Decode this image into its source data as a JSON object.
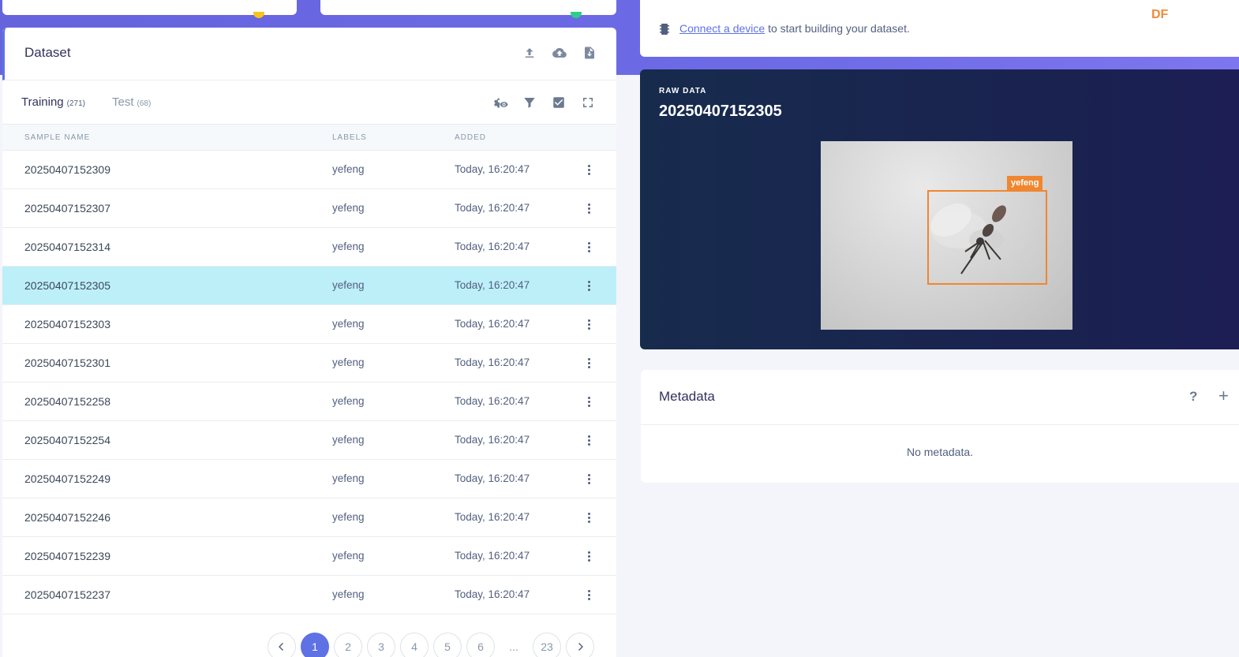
{
  "dataset": {
    "title": "Dataset",
    "tabs": {
      "training_label": "Training",
      "training_count": "(271)",
      "test_label": "Test",
      "test_count": "(68)"
    },
    "columns": {
      "name": "SAMPLE NAME",
      "labels": "LABELS",
      "added": "ADDED"
    },
    "rows": [
      {
        "name": "20250407152309",
        "label": "yefeng",
        "added": "Today, 16:20:47"
      },
      {
        "name": "20250407152307",
        "label": "yefeng",
        "added": "Today, 16:20:47"
      },
      {
        "name": "20250407152314",
        "label": "yefeng",
        "added": "Today, 16:20:47"
      },
      {
        "name": "20250407152305",
        "label": "yefeng",
        "added": "Today, 16:20:47"
      },
      {
        "name": "20250407152303",
        "label": "yefeng",
        "added": "Today, 16:20:47"
      },
      {
        "name": "20250407152301",
        "label": "yefeng",
        "added": "Today, 16:20:47"
      },
      {
        "name": "20250407152258",
        "label": "yefeng",
        "added": "Today, 16:20:47"
      },
      {
        "name": "20250407152254",
        "label": "yefeng",
        "added": "Today, 16:20:47"
      },
      {
        "name": "20250407152249",
        "label": "yefeng",
        "added": "Today, 16:20:47"
      },
      {
        "name": "20250407152246",
        "label": "yefeng",
        "added": "Today, 16:20:47"
      },
      {
        "name": "20250407152239",
        "label": "yefeng",
        "added": "Today, 16:20:47"
      },
      {
        "name": "20250407152237",
        "label": "yefeng",
        "added": "Today, 16:20:47"
      }
    ],
    "pagination": [
      "1",
      "2",
      "3",
      "4",
      "5",
      "6",
      "...",
      "23"
    ]
  },
  "connect": {
    "link": "Connect a device",
    "rest": " to start building your dataset.",
    "logo": "DF"
  },
  "raw_data": {
    "label": "RAW DATA",
    "title": "20250407152305",
    "bbox_label": "yefeng"
  },
  "metadata": {
    "title": "Metadata",
    "help": "?",
    "add": "+",
    "empty": "No metadata."
  },
  "colors": {
    "accent": "#5e72e4",
    "selected_row": "#bdeff9",
    "bbox": "#f0862f",
    "raw_bg": "#172b4d"
  }
}
